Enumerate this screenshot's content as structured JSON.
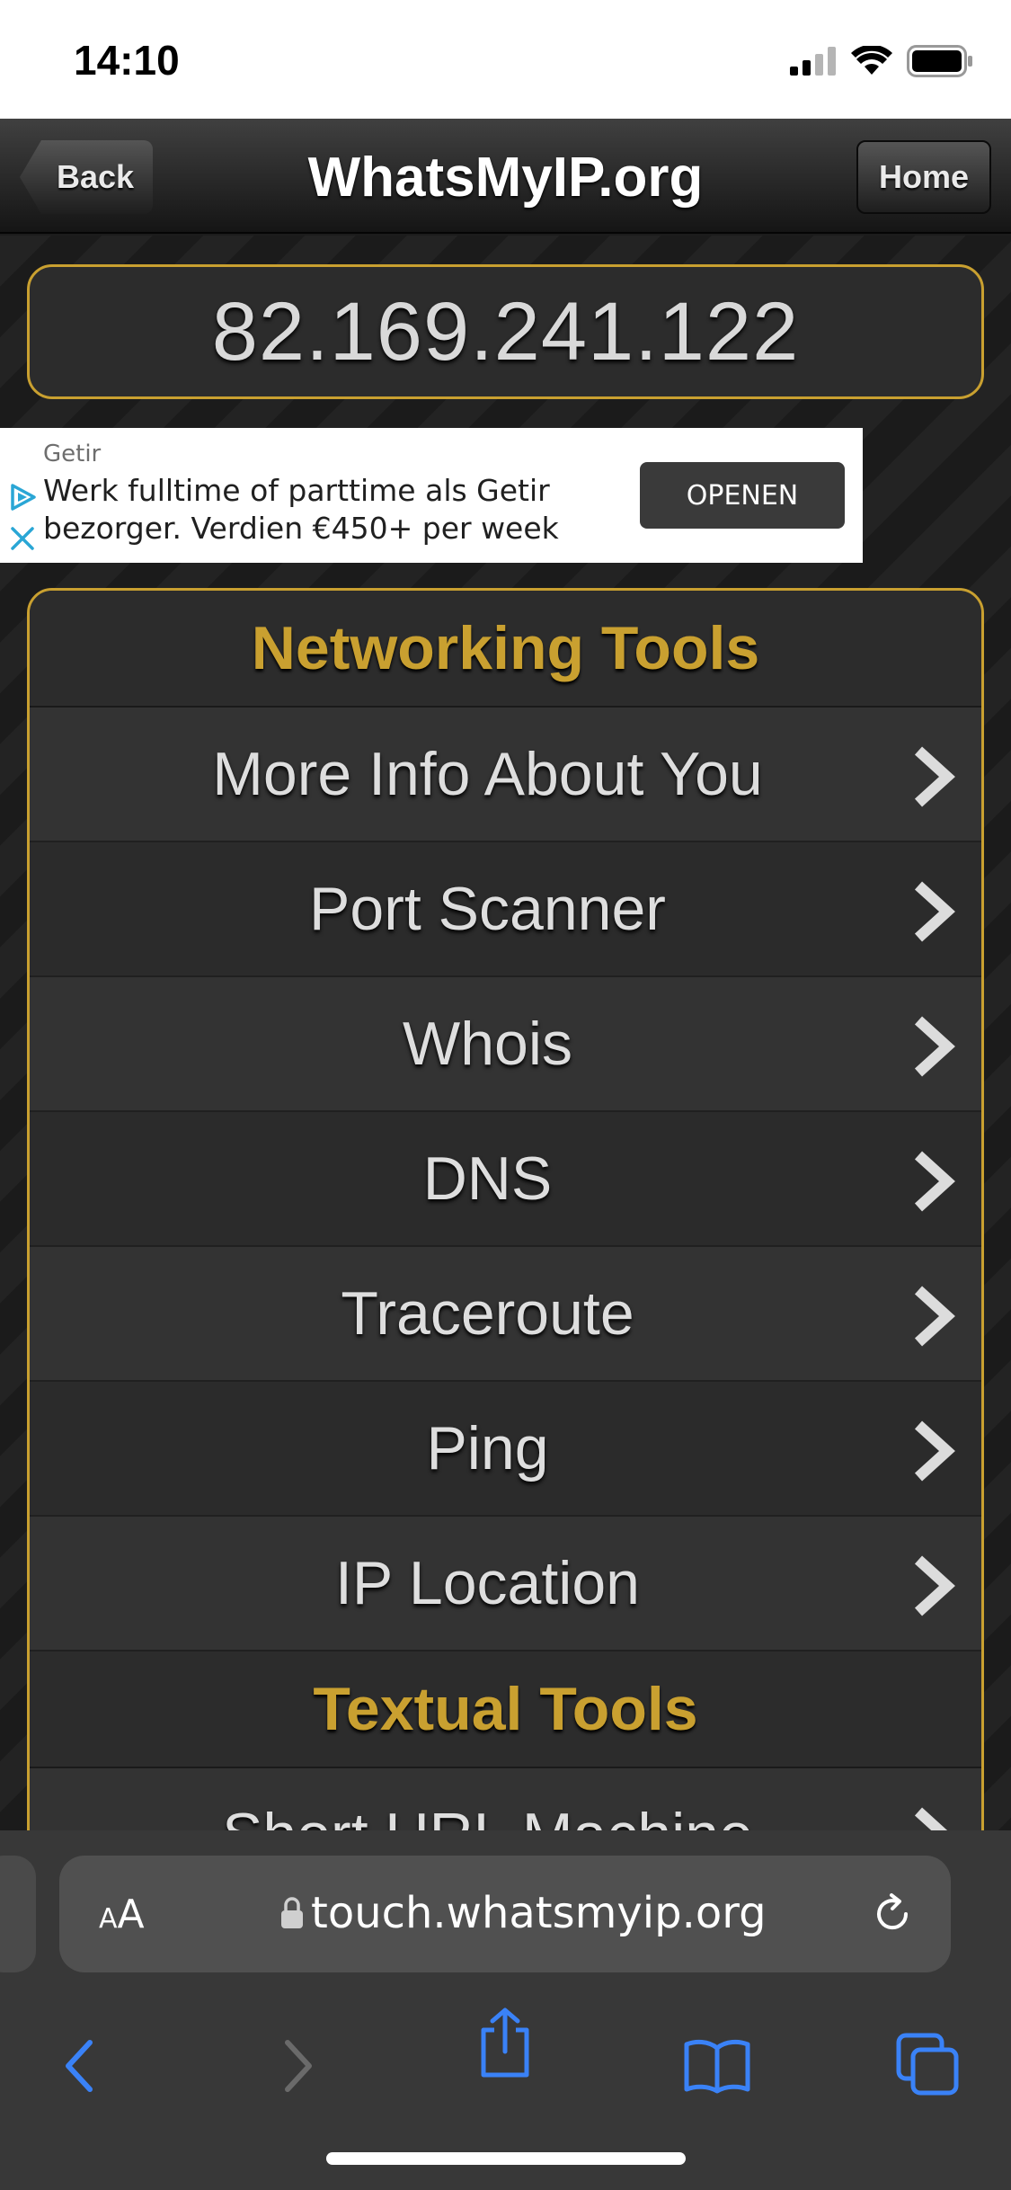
{
  "status_bar": {
    "time": "14:10"
  },
  "navbar": {
    "back_label": "Back",
    "title": "WhatsMyIP.org",
    "home_label": "Home"
  },
  "ip": {
    "address": "82.169.241.122"
  },
  "ad": {
    "sponsor": "Getir",
    "line1": "Werk fulltime of parttime als Getir",
    "line2": "bezorger. Verdien €450+ per week",
    "cta": "OPENEN"
  },
  "networking": {
    "header": "Networking Tools",
    "items": [
      {
        "label": "More Info About You"
      },
      {
        "label": "Port Scanner"
      },
      {
        "label": "Whois"
      },
      {
        "label": "DNS"
      },
      {
        "label": "Traceroute"
      },
      {
        "label": "Ping"
      },
      {
        "label": "IP Location"
      }
    ]
  },
  "textual": {
    "header": "Textual Tools",
    "items": [
      {
        "label": "Short URL Machine"
      }
    ]
  },
  "browser": {
    "aa_small": "A",
    "aa_large": "A",
    "url": "touch.whatsmyip.org"
  },
  "colors": {
    "accent_gold": "#c9a030",
    "ios_blue": "#3a82f7"
  }
}
